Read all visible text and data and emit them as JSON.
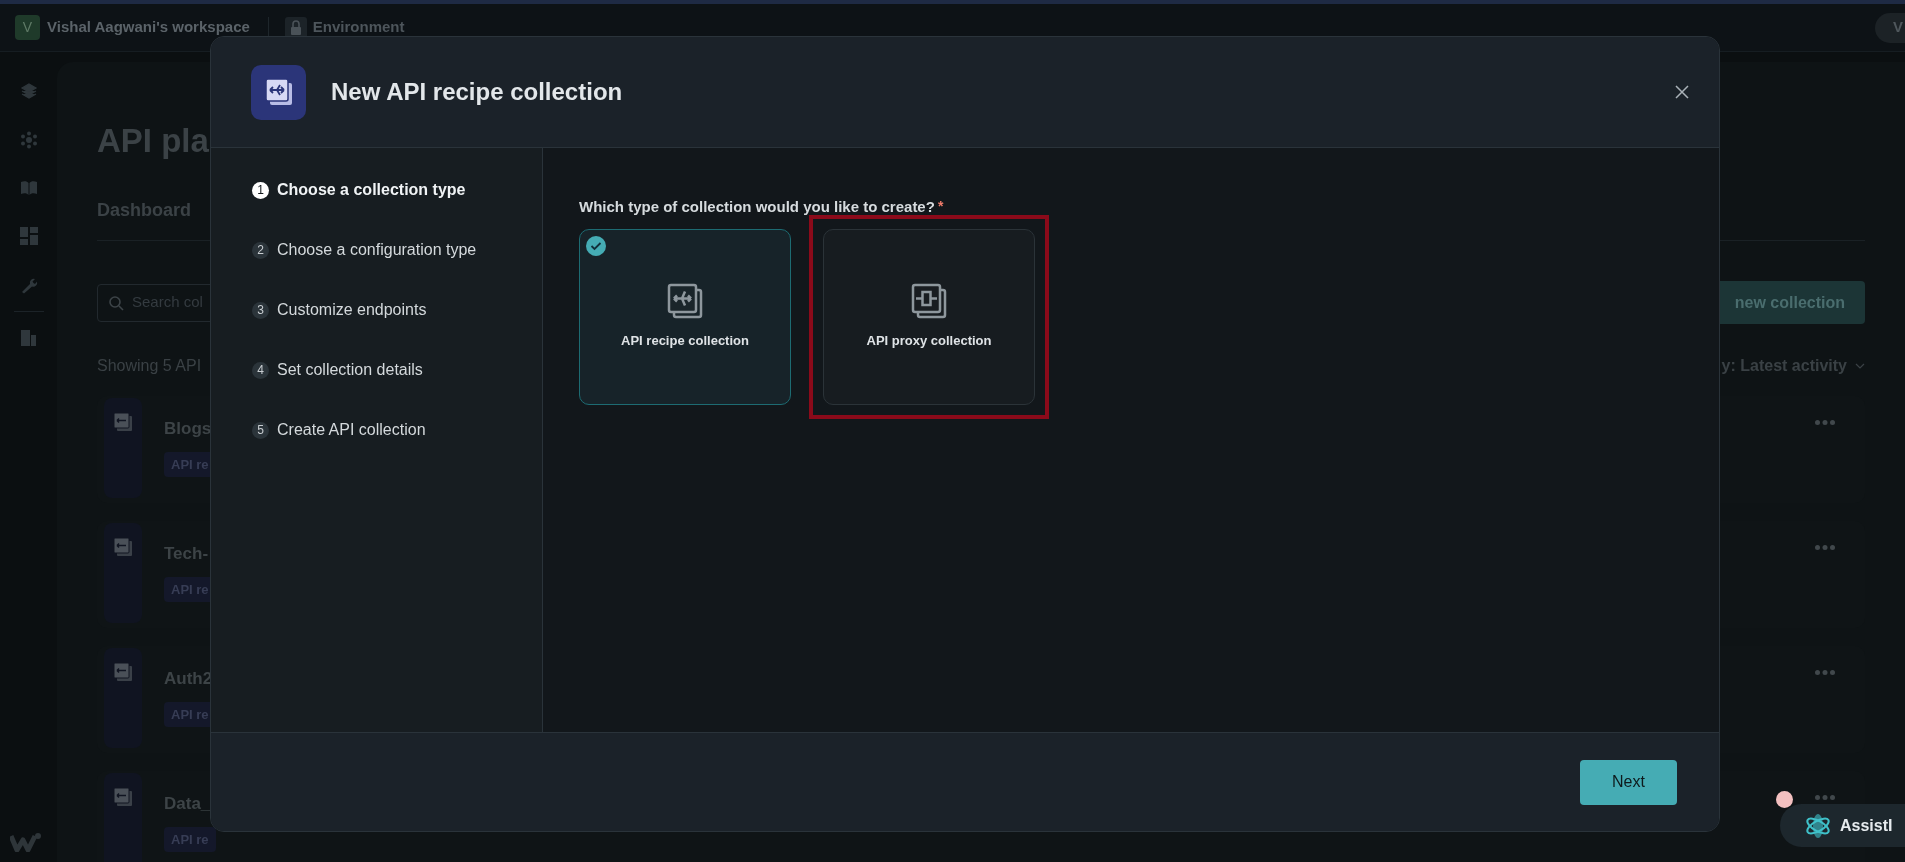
{
  "top_bar": {
    "workspace_initial": "V",
    "workspace": "Vishal Aagwani's workspace",
    "environment": "Environment",
    "avatar_initial": "V"
  },
  "page": {
    "title": "API pla",
    "tab": "Dashboard",
    "search_placeholder": "Search col",
    "summary": "Showing 5 API",
    "new_button": "new collection",
    "sort": "y: Latest activity",
    "collections": [
      {
        "name": "Blogs",
        "tag": "API re"
      },
      {
        "name": "Tech-",
        "tag": "API re"
      },
      {
        "name": "Auth2",
        "tag": "API re"
      },
      {
        "name": "Data_",
        "tag": "API re"
      }
    ]
  },
  "modal": {
    "title": "New API recipe collection",
    "steps": [
      {
        "number": "1",
        "label": "Choose a collection type",
        "selected": true
      },
      {
        "number": "2",
        "label": "Choose a configuration type",
        "selected": false
      },
      {
        "number": "3",
        "label": "Customize endpoints",
        "selected": false
      },
      {
        "number": "4",
        "label": "Set collection details",
        "selected": false
      },
      {
        "number": "5",
        "label": "Create API collection",
        "selected": false
      }
    ],
    "question": "Which type of collection would you like to create?",
    "required_mark": "*",
    "options": [
      {
        "label": "API recipe collection",
        "kind": "recipe",
        "selected": true,
        "highlighted": false
      },
      {
        "label": "API proxy collection",
        "kind": "proxy",
        "selected": false,
        "highlighted": true
      }
    ],
    "next_button": "Next"
  },
  "assistant": {
    "label": "AssistI"
  }
}
